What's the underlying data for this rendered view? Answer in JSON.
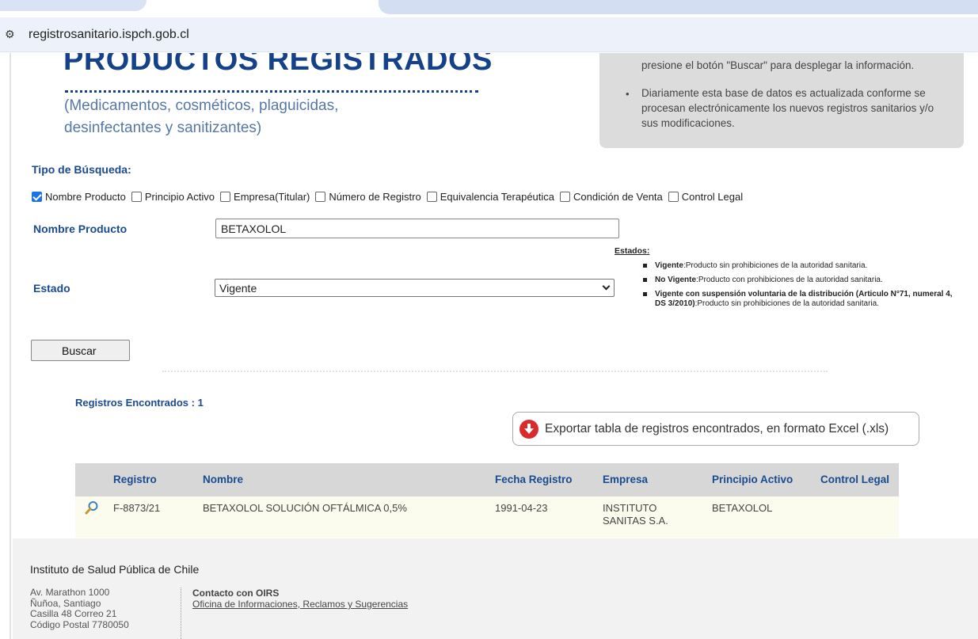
{
  "browser": {
    "url": "registrosanitario.ispch.gob.cl",
    "site_icon": "site-info-icon"
  },
  "banner": {
    "title": "PRODUCTOS REGISTRADOS",
    "subtitle_line1": "(Medicamentos, cosméticos, plaguicidas,",
    "subtitle_line2": "desinfectantes y sanitizantes)",
    "info_line1": "presione el botón \"Buscar\" para desplegar la información.",
    "info_bullet": "Diariamente esta base de datos es actualizada conforme se procesan electrónicamente los nuevos registros sanitarios y/o sus modificaciones."
  },
  "search": {
    "tipo_label": "Tipo de Búsqueda:",
    "options": [
      {
        "label": "Nombre Producto",
        "checked": true
      },
      {
        "label": "Principio Activo",
        "checked": false
      },
      {
        "label": "Empresa(Titular)",
        "checked": false
      },
      {
        "label": "Número de Registro",
        "checked": false
      },
      {
        "label": "Equivalencia Terapéutica",
        "checked": false
      },
      {
        "label": "Condición de Venta",
        "checked": false
      },
      {
        "label": "Control Legal",
        "checked": false
      }
    ],
    "nombre_label": "Nombre Producto",
    "nombre_value": "BETAXOLOL",
    "estado_label": "Estado",
    "estado_value": "Vigente",
    "buscar_label": "Buscar"
  },
  "estados": {
    "title": "Estados",
    "items": [
      {
        "term": "Vigente",
        "desc": ":Producto sin prohibiciones de la autoridad sanitaria."
      },
      {
        "term": "No Vigente",
        "desc": ":Producto con prohibiciones de la autoridad sanitaria."
      },
      {
        "term": "Vigente con suspensión voluntaria de la distribución (Articulo N°71, numeral 4, DS 3/2010)",
        "desc": ":Producto sin prohibiciones de la autoridad sanitaria."
      }
    ]
  },
  "results": {
    "count_label": "Registros Encontrados : 1",
    "export_label": "Exportar tabla de registros encontrados, en formato Excel (.xls)",
    "columns": [
      "Registro",
      "Nombre",
      "Fecha Registro",
      "Empresa",
      "Principio Activo",
      "Control Legal"
    ],
    "rows": [
      {
        "registro": "F-8873/21",
        "nombre": "BETAXOLOL SOLUCIÓN OFTÁLMICA 0,5%",
        "fecha": "1991-04-23",
        "empresa_line1": "INSTITUTO",
        "empresa_line2": "SANITAS S.A.",
        "principio": "BETAXOLOL",
        "control": ""
      }
    ]
  },
  "footer": {
    "title": "Instituto de Salud Pública de Chile",
    "address": [
      "Av. Marathon 1000",
      "Ñuñoa, Santiago",
      "Casilla 48 Correo 21",
      "Código Postal 7780050"
    ],
    "contact_title": "Contacto con OIRS",
    "contact_link": "Oficina de Informaciones, Reclamos y Sugerencias"
  },
  "colors": {
    "accent": "#1a4b8f",
    "table_header_bg": "#d7d7d7",
    "row_bg": "#fbfbee"
  }
}
